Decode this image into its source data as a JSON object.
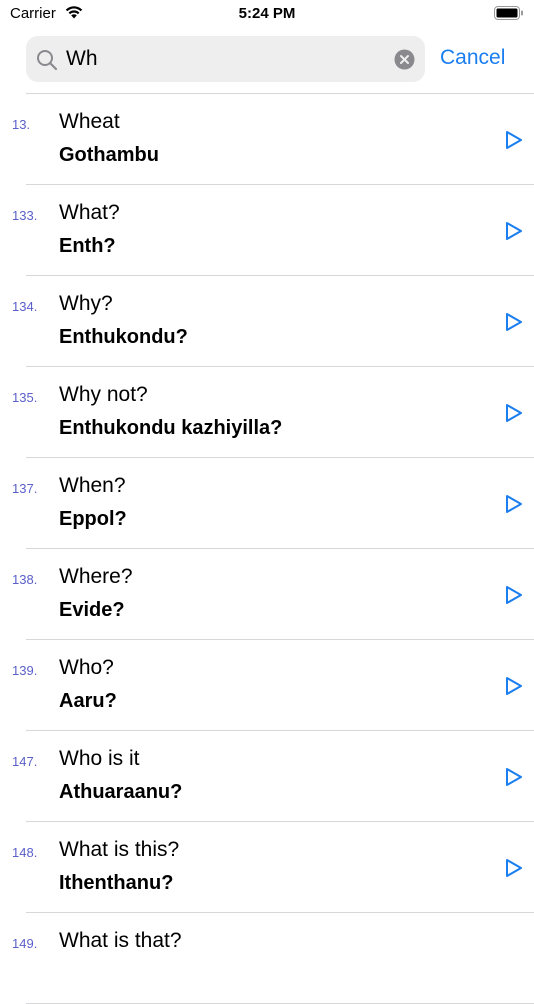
{
  "status_bar": {
    "carrier": "Carrier",
    "time": "5:24 PM"
  },
  "search": {
    "value": "Wh",
    "cancel_label": "Cancel"
  },
  "colors": {
    "accent": "#1a7ef0",
    "number": "#5a5fc9",
    "search_bg": "#eeeeef",
    "separator": "#d8d8da"
  },
  "results": [
    {
      "num": "13.",
      "english": "Wheat",
      "malayalam": "Gothambu"
    },
    {
      "num": "133.",
      "english": "What?",
      "malayalam": "Enth?"
    },
    {
      "num": "134.",
      "english": "Why?",
      "malayalam": "Enthukondu?"
    },
    {
      "num": "135.",
      "english": "Why not?",
      "malayalam": "Enthukondu kazhiyilla?"
    },
    {
      "num": "137.",
      "english": "When?",
      "malayalam": "Eppol?"
    },
    {
      "num": "138.",
      "english": "Where?",
      "malayalam": "Evide?"
    },
    {
      "num": "139.",
      "english": "Who?",
      "malayalam": "Aaru?"
    },
    {
      "num": "147.",
      "english": "Who is it",
      "malayalam": "Athuaraanu?"
    },
    {
      "num": "148.",
      "english": "What is this?",
      "malayalam": "Ithenthanu?"
    },
    {
      "num": "149.",
      "english": "What is that?",
      "malayalam": ""
    }
  ]
}
